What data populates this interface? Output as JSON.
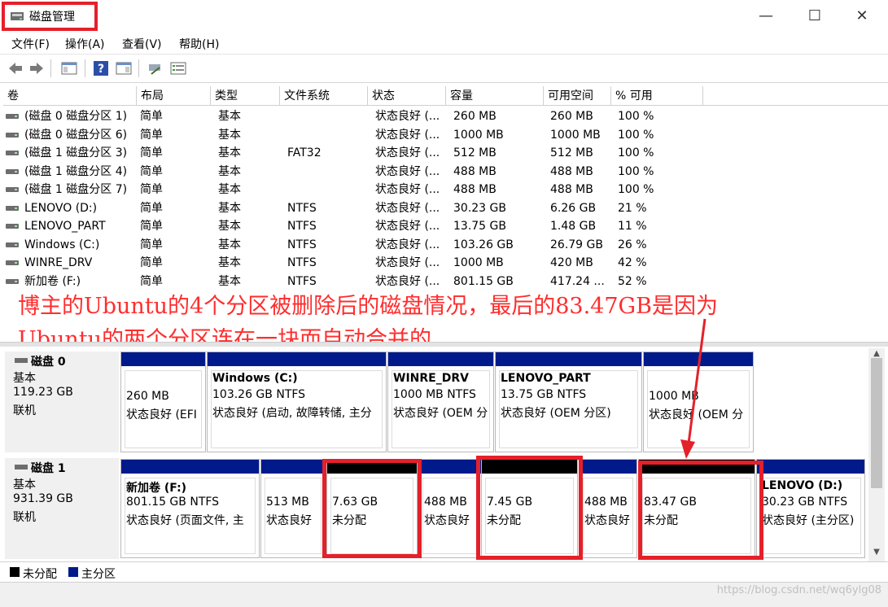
{
  "window": {
    "title": "磁盘管理",
    "min_glyph": "—",
    "max_glyph": "☐",
    "close_glyph": "✕"
  },
  "menu": [
    "文件(F)",
    "操作(A)",
    "查看(V)",
    "帮助(H)"
  ],
  "toolbar_icons": [
    "back-icon",
    "forward-icon",
    "console-tree-icon",
    "help-icon",
    "properties-icon",
    "connect-icon",
    "list-icon"
  ],
  "columns": [
    "卷",
    "布局",
    "类型",
    "文件系统",
    "状态",
    "容量",
    "可用空间",
    "% 可用"
  ],
  "volumes": [
    {
      "name": "(磁盘 0 磁盘分区 1)",
      "layout": "简单",
      "type": "基本",
      "fs": "",
      "status": "状态良好 (...",
      "capacity": "260 MB",
      "free": "260 MB",
      "pct": "100 %"
    },
    {
      "name": "(磁盘 0 磁盘分区 6)",
      "layout": "简单",
      "type": "基本",
      "fs": "",
      "status": "状态良好 (...",
      "capacity": "1000 MB",
      "free": "1000 MB",
      "pct": "100 %"
    },
    {
      "name": "(磁盘 1 磁盘分区 3)",
      "layout": "简单",
      "type": "基本",
      "fs": "FAT32",
      "status": "状态良好 (...",
      "capacity": "512 MB",
      "free": "512 MB",
      "pct": "100 %"
    },
    {
      "name": "(磁盘 1 磁盘分区 4)",
      "layout": "简单",
      "type": "基本",
      "fs": "",
      "status": "状态良好 (...",
      "capacity": "488 MB",
      "free": "488 MB",
      "pct": "100 %"
    },
    {
      "name": "(磁盘 1 磁盘分区 7)",
      "layout": "简单",
      "type": "基本",
      "fs": "",
      "status": "状态良好 (...",
      "capacity": "488 MB",
      "free": "488 MB",
      "pct": "100 %"
    },
    {
      "name": "LENOVO (D:)",
      "layout": "简单",
      "type": "基本",
      "fs": "NTFS",
      "status": "状态良好 (...",
      "capacity": "30.23 GB",
      "free": "6.26 GB",
      "pct": "21 %"
    },
    {
      "name": "LENOVO_PART",
      "layout": "简单",
      "type": "基本",
      "fs": "NTFS",
      "status": "状态良好 (...",
      "capacity": "13.75 GB",
      "free": "1.48 GB",
      "pct": "11 %"
    },
    {
      "name": "Windows (C:)",
      "layout": "简单",
      "type": "基本",
      "fs": "NTFS",
      "status": "状态良好 (...",
      "capacity": "103.26 GB",
      "free": "26.79 GB",
      "pct": "26 %"
    },
    {
      "name": "WINRE_DRV",
      "layout": "简单",
      "type": "基本",
      "fs": "NTFS",
      "status": "状态良好 (...",
      "capacity": "1000 MB",
      "free": "420 MB",
      "pct": "42 %"
    },
    {
      "name": "新加卷 (F:)",
      "layout": "简单",
      "type": "基本",
      "fs": "NTFS",
      "status": "状态良好 (...",
      "capacity": "801.15 GB",
      "free": "417.24 ...",
      "pct": "52 %"
    }
  ],
  "annotation": {
    "line1": "博主的Ubuntu的4个分区被删除后的磁盘情况，最后的83.47GB是因为",
    "line2": "Ubuntu的两个分区连在一块而自动合并的"
  },
  "disks": [
    {
      "name": "磁盘 0",
      "type": "基本",
      "size": "119.23 GB",
      "state": "联机",
      "partitions": [
        {
          "title": "",
          "size": "260 MB",
          "status": "状态良好 (EFI",
          "kind": "primary"
        },
        {
          "title": "Windows  (C:)",
          "size": "103.26 GB NTFS",
          "status": "状态良好 (启动, 故障转储, 主分",
          "kind": "primary"
        },
        {
          "title": "WINRE_DRV",
          "size": "1000 MB NTFS",
          "status": "状态良好 (OEM 分",
          "kind": "primary"
        },
        {
          "title": "LENOVO_PART",
          "size": "13.75 GB NTFS",
          "status": "状态良好 (OEM 分区)",
          "kind": "primary"
        },
        {
          "title": "",
          "size": "1000 MB",
          "status": "状态良好 (OEM 分",
          "kind": "primary"
        }
      ]
    },
    {
      "name": "磁盘 1",
      "type": "基本",
      "size": "931.39 GB",
      "state": "联机",
      "partitions": [
        {
          "title": "新加卷  (F:)",
          "size": "801.15 GB NTFS",
          "status": "状态良好 (页面文件, 主",
          "kind": "primary"
        },
        {
          "title": "",
          "size": "513 MB",
          "status": "状态良好",
          "kind": "primary"
        },
        {
          "title": "",
          "size": "7.63 GB",
          "status": "未分配",
          "kind": "unallocated"
        },
        {
          "title": "",
          "size": "488 MB",
          "status": "状态良好",
          "kind": "primary"
        },
        {
          "title": "",
          "size": "7.45 GB",
          "status": "未分配",
          "kind": "unallocated"
        },
        {
          "title": "",
          "size": "488 MB",
          "status": "状态良好",
          "kind": "primary"
        },
        {
          "title": "",
          "size": "83.47 GB",
          "status": "未分配",
          "kind": "unallocated"
        },
        {
          "title": "LENOVO  (D:)",
          "size": "30.23 GB NTFS",
          "status": "状态良好 (主分区)",
          "kind": "primary"
        }
      ]
    }
  ],
  "legend": {
    "unallocated": "未分配",
    "primary": "主分区"
  },
  "watermark": "https://blog.csdn.net/wq6ylg08",
  "colors": {
    "primary": "#001a8c",
    "unallocated": "#000000",
    "annotation": "#ff2d2d",
    "highlight_box": "#e4202a"
  }
}
